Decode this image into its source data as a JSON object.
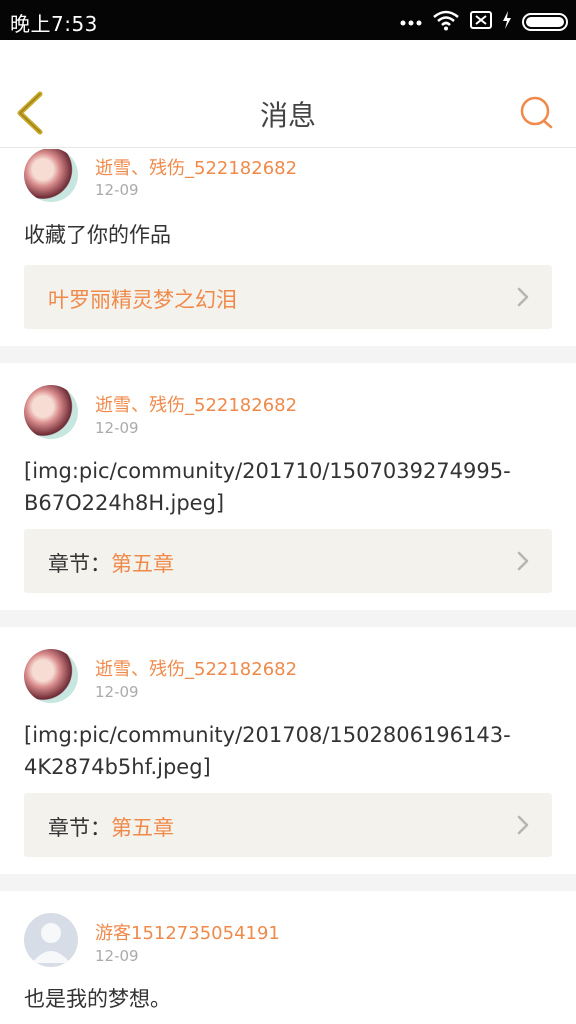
{
  "status_bar": {
    "time": "晚上7:53"
  },
  "header": {
    "title": "消息",
    "back_icon": "chevron-left-icon",
    "search_icon": "search-icon"
  },
  "colors": {
    "accent": "#f08a4b",
    "ref_bg": "#f3f2ed",
    "gap_bg": "#f4f4f4"
  },
  "feed": {
    "items": [
      {
        "user": "逝雪、残伤_522182682",
        "date": "12-09",
        "message": "收藏了你的作品",
        "ref_text": "叶罗丽精灵梦之幻泪"
      },
      {
        "user": "逝雪、残伤_522182682",
        "date": "12-09",
        "message": "[img:pic/community/201710/1507039274995-B67O224h8H.jpeg]",
        "ref_label": "章节：",
        "ref_value": "第五章"
      },
      {
        "user": "逝雪、残伤_522182682",
        "date": "12-09",
        "message": "[img:pic/community/201708/1502806196143-4K2874b5hf.jpeg]",
        "ref_label": "章节：",
        "ref_value": "第五章"
      },
      {
        "user": "游客1512735054191",
        "date": "12-09",
        "message": "也是我的梦想。"
      }
    ]
  }
}
